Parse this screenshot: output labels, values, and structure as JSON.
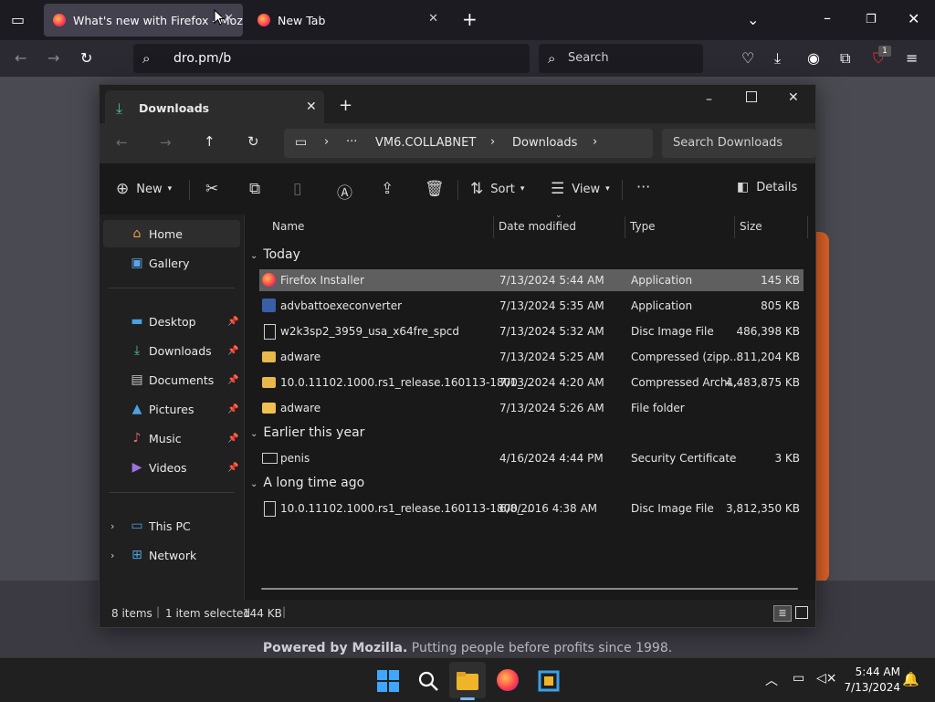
{
  "browser": {
    "tabs": [
      {
        "title": "What's new with Firefox - Moz"
      },
      {
        "title": "New Tab"
      }
    ],
    "url": "dro.pm/b",
    "search_placeholder": "Search",
    "extension_badge": "1"
  },
  "page": {
    "footer_bold": "Powered by Mozilla.",
    "footer_text": " Putting people before profits since 1998."
  },
  "explorer": {
    "tab_title": "Downloads",
    "breadcrumb": [
      "VM6.COLLABNET",
      "Downloads"
    ],
    "breadcrumb_more": "···",
    "search_placeholder": "Search Downloads",
    "commands": {
      "new": "New",
      "sort": "Sort",
      "view": "View",
      "more": "···",
      "details": "Details"
    },
    "nav": [
      {
        "label": "Home",
        "icon": "home-icon"
      },
      {
        "label": "Gallery",
        "icon": "gallery-icon"
      },
      {
        "label": "Desktop",
        "icon": "desktop-icon",
        "pinned": true
      },
      {
        "label": "Downloads",
        "icon": "download-icon",
        "pinned": true
      },
      {
        "label": "Documents",
        "icon": "documents-icon",
        "pinned": true
      },
      {
        "label": "Pictures",
        "icon": "pictures-icon",
        "pinned": true
      },
      {
        "label": "Music",
        "icon": "music-icon",
        "pinned": true
      },
      {
        "label": "Videos",
        "icon": "videos-icon",
        "pinned": true
      },
      {
        "label": "This PC",
        "icon": "pc-icon"
      },
      {
        "label": "Network",
        "icon": "network-icon"
      }
    ],
    "columns": {
      "name": "Name",
      "date": "Date modified",
      "type": "Type",
      "size": "Size"
    },
    "groups": [
      {
        "label": "Today"
      },
      {
        "label": "Earlier this year"
      },
      {
        "label": "A long time ago"
      }
    ],
    "files": [
      {
        "name": "Firefox Installer",
        "date": "7/13/2024 5:44 AM",
        "type": "Application",
        "size": "145 KB"
      },
      {
        "name": "advbattoexeconverter",
        "date": "7/13/2024 5:35 AM",
        "type": "Application",
        "size": "805 KB"
      },
      {
        "name": "w2k3sp2_3959_usa_x64fre_spcd",
        "date": "7/13/2024 5:32 AM",
        "type": "Disc Image File",
        "size": "486,398 KB"
      },
      {
        "name": "adware",
        "date": "7/13/2024 5:25 AM",
        "type": "Compressed (zipp...",
        "size": "811,204 KB"
      },
      {
        "name": "10.0.11102.1000.rs1_release.160113-1800_...",
        "date": "7/13/2024 4:20 AM",
        "type": "Compressed Archi...",
        "size": "4,483,875 KB"
      },
      {
        "name": "adware",
        "date": "7/13/2024 5:26 AM",
        "type": "File folder",
        "size": ""
      },
      {
        "name": "penis",
        "date": "4/16/2024 4:44 PM",
        "type": "Security Certificate",
        "size": "3 KB"
      },
      {
        "name": "10.0.11102.1000.rs1_release.160113-1800_...",
        "date": "6/8/2016 4:38 AM",
        "type": "Disc Image File",
        "size": "3,812,350 KB"
      }
    ],
    "status": {
      "count": "8 items",
      "selected": "1 item selected",
      "size": "144 KB"
    }
  },
  "taskbar": {
    "time": "5:44 AM",
    "date": "7/13/2024"
  }
}
